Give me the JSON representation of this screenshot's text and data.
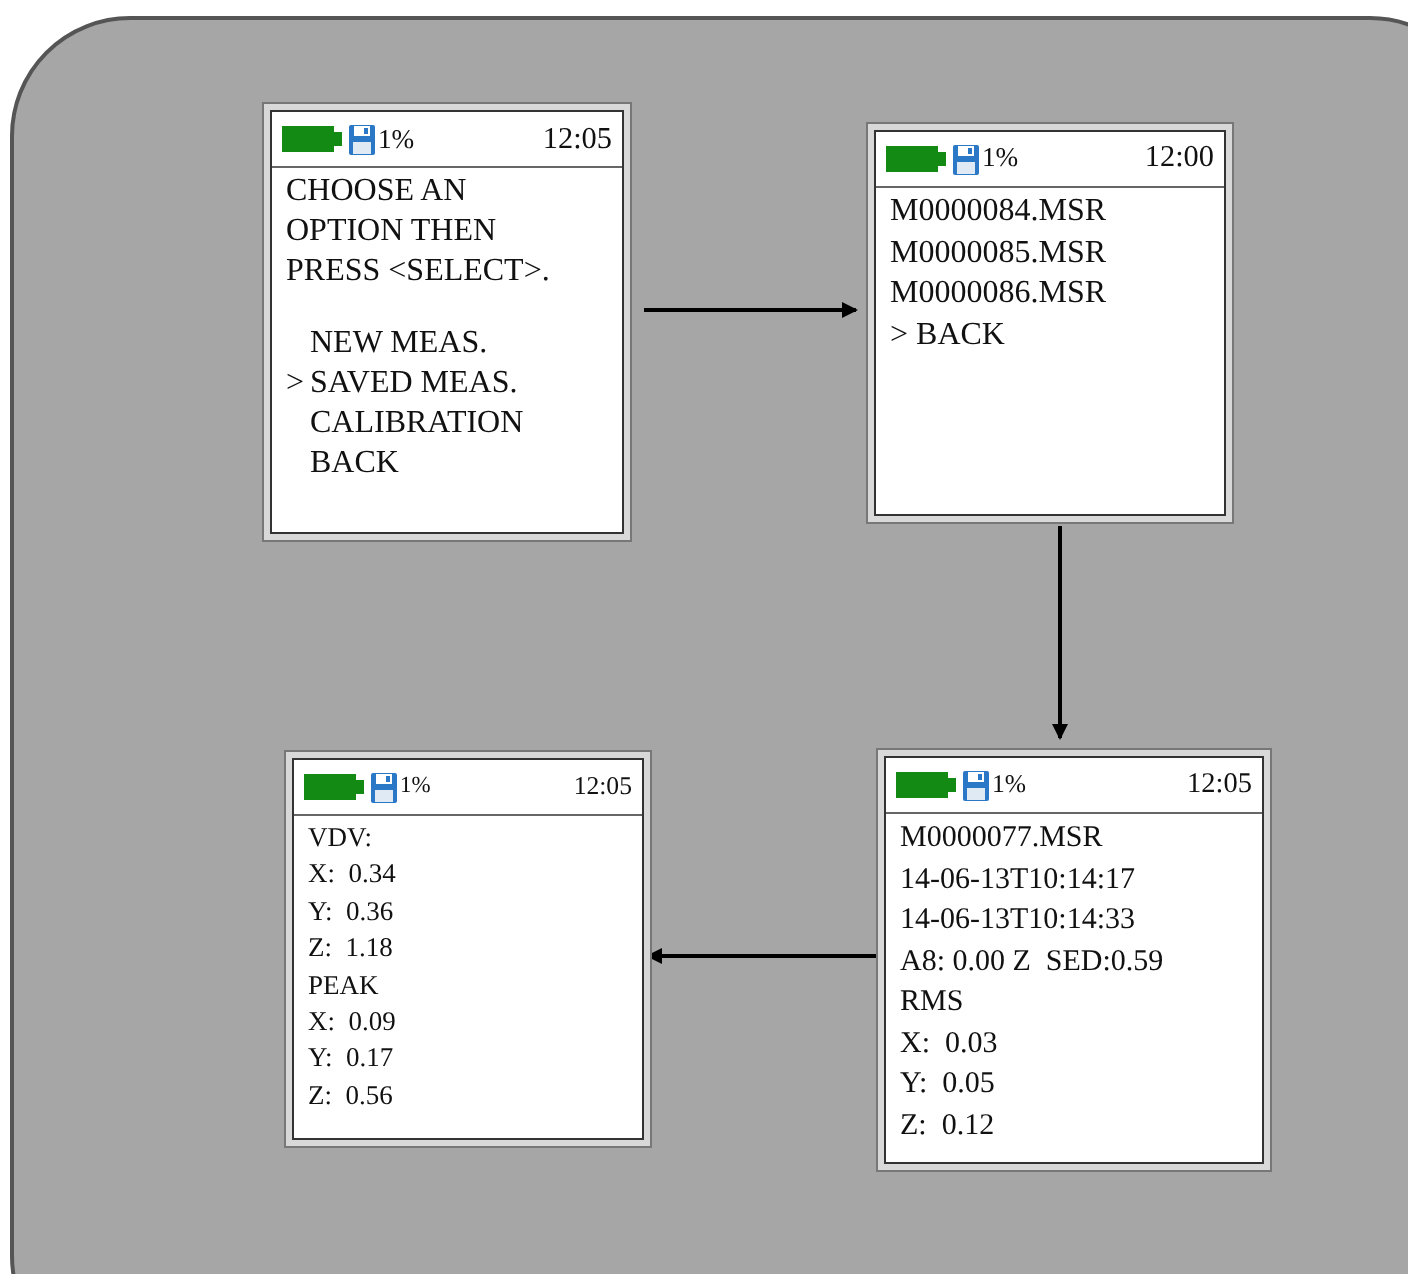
{
  "screens": [
    {
      "status": {
        "memory": "1%",
        "time": "12:05"
      },
      "prompt": [
        "CHOOSE AN",
        "OPTION THEN",
        "PRESS <SELECT>."
      ],
      "menu": [
        {
          "label": "NEW MEAS."
        },
        {
          "marker": ">",
          "label": "SAVED MEAS."
        },
        {
          "label": "CALIBRATION"
        },
        {
          "label": "BACK"
        }
      ]
    },
    {
      "status": {
        "memory": "1%",
        "time": "12:00"
      },
      "lines": [
        "M0000084.MSR",
        "M0000085.MSR",
        "M0000086.MSR",
        "> BACK"
      ]
    },
    {
      "status": {
        "memory": "1%",
        "time": "12:05"
      },
      "lines": [
        "VDV:",
        "X:  0.34",
        "Y:  0.36",
        "Z:  1.18",
        "PEAK",
        "X:  0.09",
        "Y:  0.17",
        "Z:  0.56"
      ]
    },
    {
      "status": {
        "memory": "1%",
        "time": "12:05"
      },
      "lines": [
        "M0000077.MSR",
        "14-06-13T10:14:17",
        "14-06-13T10:14:33",
        "A8: 0.00 Z  SED:0.59",
        "RMS",
        "X:  0.03",
        "Y:  0.05",
        "Z:  0.12"
      ]
    }
  ]
}
